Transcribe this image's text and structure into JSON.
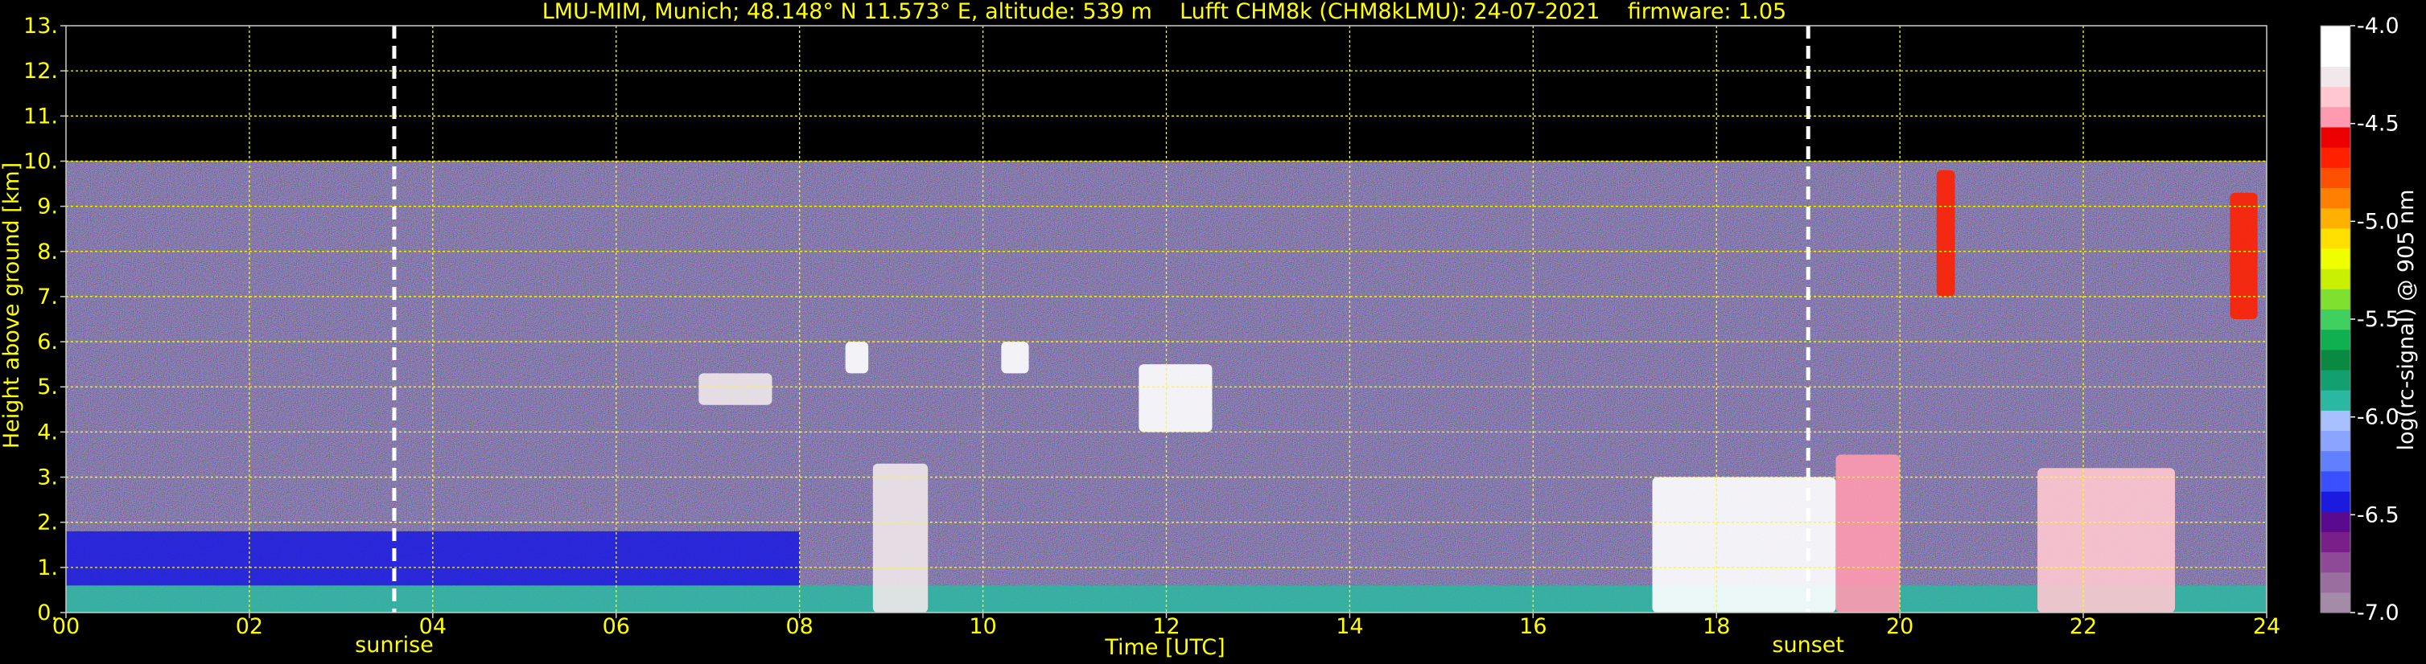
{
  "chart_data": {
    "type": "heatmap",
    "title": "LMU-MIM, Munich; 48.148° N 11.573° E, altitude: 539 m    Lufft CHM8k (CHM8kLMU): 24-07-2021    firmware: 1.05",
    "xlabel": "Time [UTC]",
    "ylabel": "Height above ground [km]",
    "xlim": [
      0,
      24
    ],
    "ylim": [
      0,
      13
    ],
    "x_ticks": [
      "00",
      "02",
      "04",
      "06",
      "08",
      "10",
      "12",
      "14",
      "16",
      "18",
      "20",
      "22",
      "24"
    ],
    "y_ticks": [
      "0.",
      "1.",
      "2.",
      "3.",
      "4.",
      "5.",
      "6.",
      "7.",
      "8.",
      "9.",
      "10.",
      "11.",
      "12.",
      "13."
    ],
    "grid": true,
    "grid_color": "#ffff00",
    "text_color": "#ffff00",
    "background": "#000000",
    "signal_top_km": 10,
    "markers": [
      {
        "label": "sunrise",
        "time": 3.58
      },
      {
        "label": "sunset",
        "time": 19.0
      }
    ],
    "colorbar": {
      "label": "log(rc-signal) @ 905 nm",
      "range": [
        -7.0,
        -4.0
      ],
      "tick_values": [
        -4.0,
        -4.5,
        -5.0,
        -5.5,
        -6.0,
        -6.5,
        -7.0
      ],
      "tick_labels": [
        "-4.0",
        "-4.5",
        "-5.0",
        "-5.5",
        "-6.0",
        "-6.5",
        "-7.0"
      ],
      "colors": [
        "#a48ca8",
        "#9a6fa0",
        "#8e4a96",
        "#7a1f8a",
        "#5a0a8e",
        "#1a1ae0",
        "#3a50ff",
        "#6080ff",
        "#8aa4ff",
        "#a8c0ff",
        "#2ab8a0",
        "#12a070",
        "#0a8a40",
        "#10b050",
        "#40d060",
        "#80e030",
        "#c8f000",
        "#f0ff00",
        "#ffe000",
        "#ffb000",
        "#ff8000",
        "#ff5000",
        "#ff2000",
        "#ee0000",
        "#ff9ab0",
        "#ffc8d0",
        "#f0e8ea",
        "#ffffff",
        "#ffffff"
      ]
    },
    "features": [
      {
        "kind": "boundary_layer",
        "t": [
          0,
          24
        ],
        "h": [
          0,
          0.6
        ],
        "level": -5.9
      },
      {
        "kind": "residual_layer",
        "t": [
          0,
          8
        ],
        "h": [
          0.6,
          1.8
        ],
        "level": -6.4
      },
      {
        "kind": "cloud",
        "t": [
          8.8,
          9.4
        ],
        "h": [
          0,
          3.3
        ],
        "level": -4.3
      },
      {
        "kind": "cloud",
        "t": [
          6.9,
          7.7
        ],
        "h": [
          4.6,
          5.3
        ],
        "level": -4.3
      },
      {
        "kind": "cloud",
        "t": [
          8.5,
          8.75
        ],
        "h": [
          5.3,
          6.0
        ],
        "level": -4.0
      },
      {
        "kind": "cloud",
        "t": [
          10.2,
          10.5
        ],
        "h": [
          5.3,
          6.0
        ],
        "level": -4.0
      },
      {
        "kind": "cloud",
        "t": [
          11.7,
          12.5
        ],
        "h": [
          4.0,
          5.5
        ],
        "level": -4.2
      },
      {
        "kind": "cloud",
        "t": [
          17.3,
          19.3
        ],
        "h": [
          0,
          3.0
        ],
        "level": -4.0
      },
      {
        "kind": "cloud",
        "t": [
          19.3,
          20.0
        ],
        "h": [
          0,
          3.5
        ],
        "level": -4.5
      },
      {
        "kind": "cloud",
        "t": [
          21.5,
          23.0
        ],
        "h": [
          0,
          3.2
        ],
        "level": -4.4
      },
      {
        "kind": "cloud",
        "t": [
          20.4,
          20.6
        ],
        "h": [
          7.0,
          9.8
        ],
        "level": -4.7
      },
      {
        "kind": "cloud",
        "t": [
          23.6,
          23.9
        ],
        "h": [
          6.5,
          9.3
        ],
        "level": -4.7
      }
    ]
  }
}
